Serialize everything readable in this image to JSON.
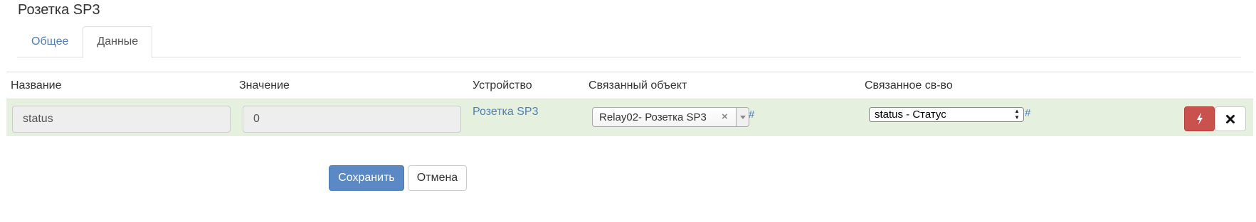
{
  "page": {
    "title": "Розетка SP3"
  },
  "tabs": [
    {
      "label": "Общее",
      "active": false
    },
    {
      "label": "Данные",
      "active": true
    }
  ],
  "table": {
    "headers": {
      "name": "Название",
      "value": "Значение",
      "device": "Устройство",
      "linked_object": "Связанный объект",
      "linked_property": "Связанное св-во"
    },
    "row": {
      "name": "status",
      "value": "0",
      "device": "Розетка SP3",
      "linked_object": "Relay02- Розетка SP3",
      "linked_object_clear": "×",
      "linked_object_hash": "#",
      "linked_property": "status - Статус",
      "linked_property_hash": "#"
    }
  },
  "actions": {
    "save_label": "Сохранить",
    "cancel_label": "Отмена"
  },
  "icons": {
    "trigger": "bolt-icon",
    "delete": "close-icon",
    "dropdown": "chevron-down-icon",
    "spinner": "select-arrows-icon"
  },
  "colors": {
    "link": "#4f7fb5",
    "row_highlight": "#e6f0de",
    "primary": "#5a89c6",
    "danger": "#c9524e"
  }
}
